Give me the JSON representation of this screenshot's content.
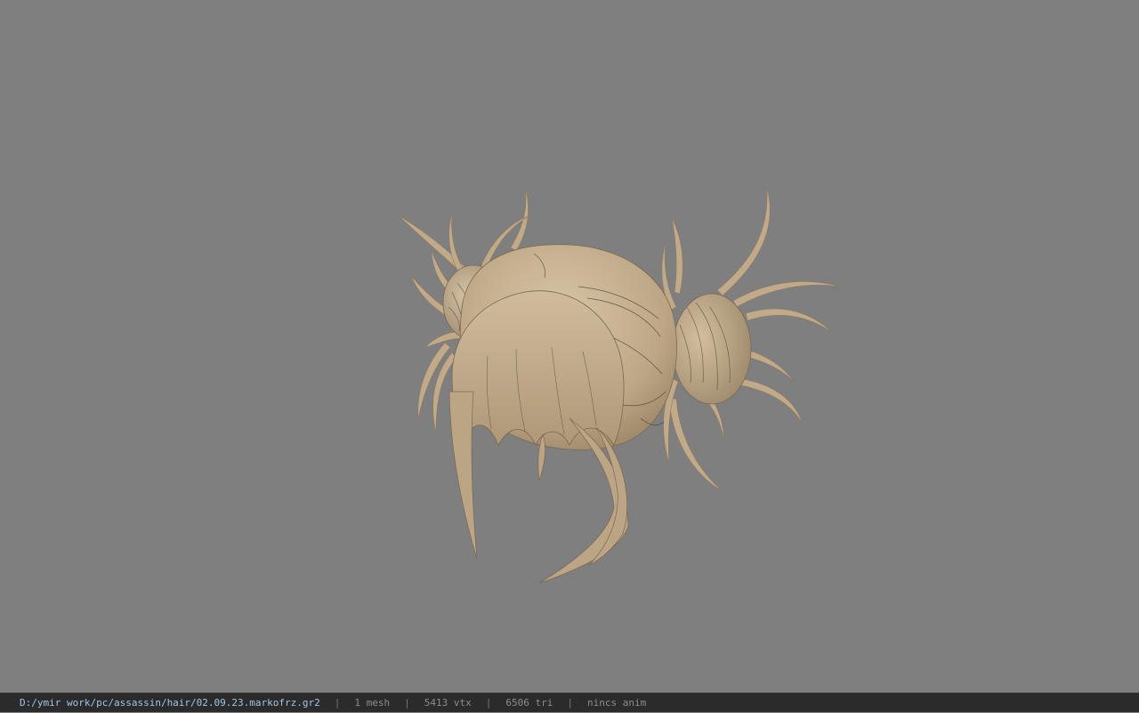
{
  "viewport": {
    "background": "#7f7f7f",
    "model_color": "#c1ab8c",
    "model_shadow": "#9a8669",
    "model_highlight": "#d6c3a6",
    "object": "hair-mesh"
  },
  "statusbar": {
    "file_path": "D:/ymir work/pc/assassin/hair/02.09.23.markofrz.gr2",
    "mesh_count": "1 mesh",
    "vertex_count": "5413 vtx",
    "triangle_count": "6506 tri",
    "anim_status": "nincs anim",
    "separator": "|"
  }
}
